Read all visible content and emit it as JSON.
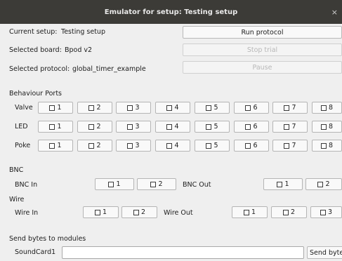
{
  "window": {
    "title": "Emulator for setup: Testing setup",
    "close_glyph": "×"
  },
  "setup": {
    "current_setup_label": "Current setup:",
    "current_setup_value": "Testing setup",
    "selected_board_label": "Selected board:",
    "selected_board_value": "Bpod v2",
    "selected_protocol_label": "Selected protocol:",
    "selected_protocol_value": "global_timer_example"
  },
  "controls": {
    "run_label": "Run protocol",
    "stop_label": "Stop trial",
    "pause_label": "Pause"
  },
  "ports": {
    "title": "Behaviour Ports",
    "rows": [
      {
        "label": "Valve",
        "channels": [
          "1",
          "2",
          "3",
          "4",
          "5",
          "6",
          "7",
          "8"
        ]
      },
      {
        "label": "LED",
        "channels": [
          "1",
          "2",
          "3",
          "4",
          "5",
          "6",
          "7",
          "8"
        ]
      },
      {
        "label": "Poke",
        "channels": [
          "1",
          "2",
          "3",
          "4",
          "5",
          "6",
          "7",
          "8"
        ]
      }
    ]
  },
  "bnc": {
    "title": "BNC",
    "in_label": "BNC In",
    "in_channels": [
      "1",
      "2"
    ],
    "out_label": "BNC Out",
    "out_channels": [
      "1",
      "2"
    ]
  },
  "wire": {
    "title": "Wire",
    "in_label": "Wire In",
    "in_channels": [
      "1",
      "2"
    ],
    "out_label": "Wire Out",
    "out_channels": [
      "1",
      "2",
      "3"
    ]
  },
  "modules": {
    "title": "Send bytes to modules",
    "module_name": "SoundCard1",
    "input_value": "",
    "send_label": "Send bytes"
  }
}
